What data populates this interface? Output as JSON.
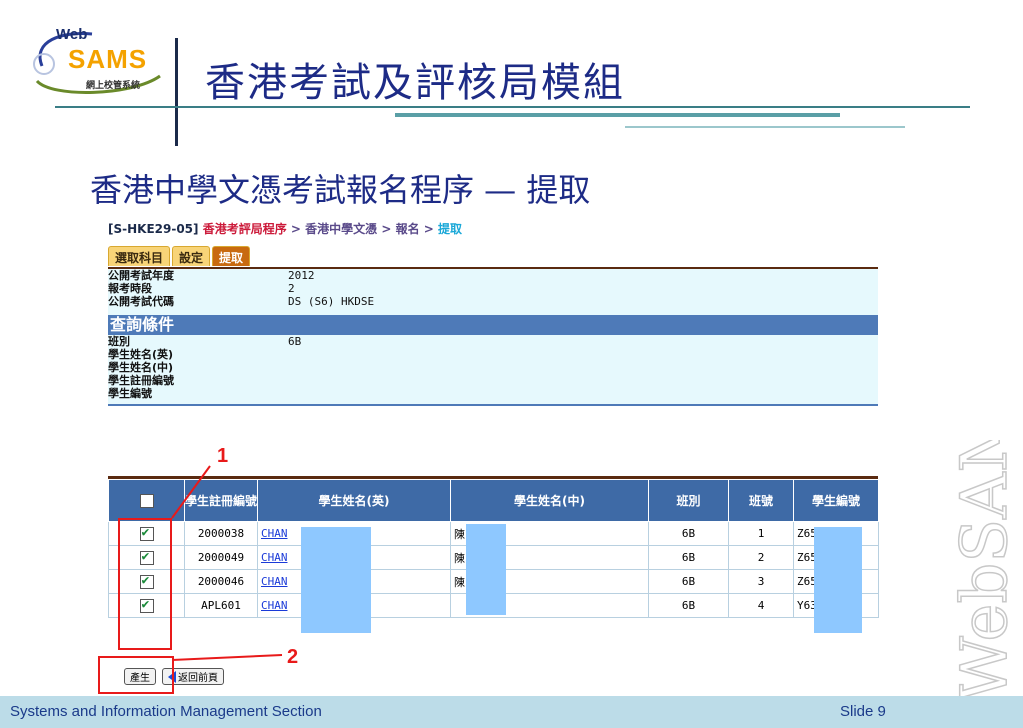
{
  "header": {
    "logo_web": "Web",
    "logo_sams": "SAMS",
    "logo_sub": "網上校管系統",
    "module_title": "香港考試及評核局模組"
  },
  "slide_heading": "香港中學文憑考試報名程序 — 提取",
  "breadcrumb": {
    "code": "[S-HKE29-05]",
    "path1": "香港考評局程序",
    "path2": "香港中學文憑",
    "path3": "報名",
    "current": "提取",
    "sep": " > "
  },
  "tabs": [
    "選取科目",
    "設定",
    "提取"
  ],
  "info": [
    {
      "label": "公開考試年度",
      "value": "2012"
    },
    {
      "label": "報考時段",
      "value": "2"
    },
    {
      "label": "公開考試代碼",
      "value": "DS (S6) HKDSE"
    }
  ],
  "query": {
    "title": "查詢條件",
    "fields": [
      {
        "label": "班別",
        "value": "6B"
      },
      {
        "label": "學生姓名(英)",
        "value": ""
      },
      {
        "label": "學生姓名(中)",
        "value": ""
      },
      {
        "label": "學生註冊編號",
        "value": ""
      },
      {
        "label": "學生編號",
        "value": ""
      }
    ]
  },
  "table": {
    "headers": [
      "學生註冊編號",
      "學生姓名(英)",
      "學生姓名(中)",
      "班別",
      "班號",
      "學生編號"
    ],
    "rows": [
      {
        "checked": true,
        "reg": "2000038",
        "eng": "CHAN",
        "chi": "陳",
        "cls": "6B",
        "no": "1",
        "sid": "Z65"
      },
      {
        "checked": true,
        "reg": "2000049",
        "eng": "CHAN",
        "chi": "陳",
        "cls": "6B",
        "no": "2",
        "sid": "Z65"
      },
      {
        "checked": true,
        "reg": "2000046",
        "eng": "CHAN",
        "chi": "陳",
        "cls": "6B",
        "no": "3",
        "sid": "Z65"
      },
      {
        "checked": true,
        "reg": "APL601",
        "eng": "CHAN",
        "chi": "",
        "cls": "6B",
        "no": "4",
        "sid": "Y63"
      }
    ]
  },
  "buttons": {
    "generate": "產生",
    "back": "返回前頁"
  },
  "annotations": {
    "marker1": "1",
    "marker2": "2"
  },
  "watermark": "WebSAMS",
  "footer": {
    "left": "Systems and Information Management Section",
    "right": "Slide 9"
  },
  "colors": {
    "title_blue": "#1d2b86",
    "table_header": "#3e6aa6",
    "annotation_red": "#e81a1a",
    "panel_bg": "#e6f9fd"
  }
}
